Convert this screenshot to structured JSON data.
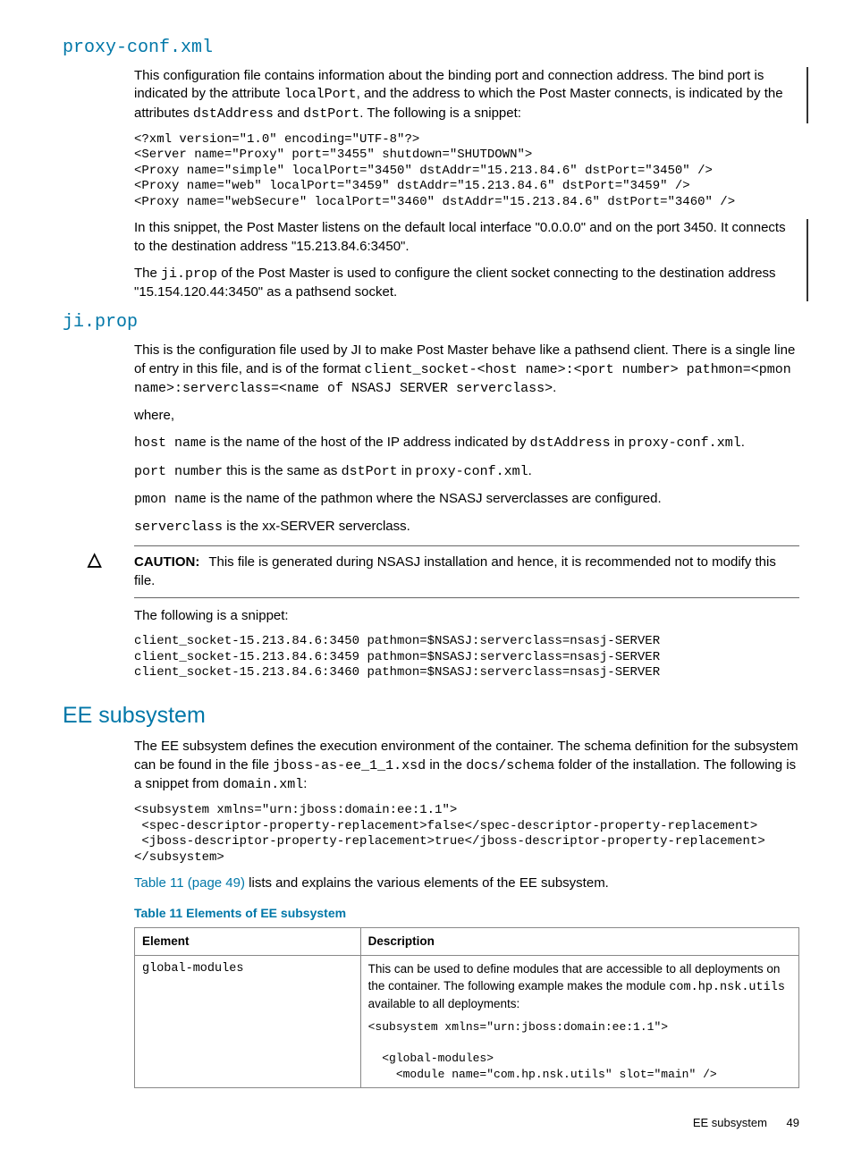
{
  "sections": {
    "proxy": {
      "title": "proxy-conf.xml",
      "p1a": "This configuration file contains information about the binding port and connection address. The bind port is indicated by the attribute ",
      "p1b": "localPort",
      "p1c": ", and the address to which the Post Master connects, is indicated by the attributes ",
      "p1d": "dstAddress",
      "p1e": " and ",
      "p1f": "dstPort",
      "p1g": ". The following is a snippet:",
      "code": "<?xml version=\"1.0\" encoding=\"UTF-8\"?>\n<Server name=\"Proxy\" port=\"3455\" shutdown=\"SHUTDOWN\">\n<Proxy name=\"simple\" localPort=\"3450\" dstAddr=\"15.213.84.6\" dstPort=\"3450\" />\n<Proxy name=\"web\" localPort=\"3459\" dstAddr=\"15.213.84.6\" dstPort=\"3459\" />\n<Proxy name=\"webSecure\" localPort=\"3460\" dstAddr=\"15.213.84.6\" dstPort=\"3460\" />",
      "p2": "In this snippet, the Post Master listens on the default local interface \"0.0.0.0\" and on the port 3450. It connects to the destination address \"15.213.84.6:3450\".",
      "p3a": "The ",
      "p3b": "ji.prop",
      "p3c": " of the Post Master is used to configure the client socket connecting to the destination address \"15.154.120.44:3450\" as a pathsend socket."
    },
    "ji": {
      "title": "ji.prop",
      "p1a": "This is the configuration file used by JI to make Post Master behave like a pathsend client. There is a single line of entry in this file, and is of the format ",
      "p1b": "client_socket-<host name>:<port number> pathmon=<pmon name>:serverclass=<name of NSASJ SERVER serverclass>",
      "p1c": ".",
      "where": "where,",
      "w1a": "host name",
      "w1b": " is the name of the host of the IP address indicated by ",
      "w1c": "dstAddress",
      "w1d": " in ",
      "w1e": "proxy-conf.xml",
      "w1f": ".",
      "w2a": "port number",
      "w2b": " this is the same as ",
      "w2c": "dstPort",
      "w2d": " in ",
      "w2e": "proxy-conf.xml",
      "w2f": ".",
      "w3a": "pmon name",
      "w3b": " is the name of the pathmon where the NSASJ serverclasses are configured.",
      "w4a": "serverclass",
      "w4b": " is the xx-SERVER serverclass.",
      "cautionLabel": "CAUTION:",
      "cautionText": "This file is generated during NSASJ installation and hence, it is recommended not to modify this file.",
      "p2": "The following is a snippet:",
      "code": "client_socket-15.213.84.6:3450 pathmon=$NSASJ:serverclass=nsasj-SERVER\nclient_socket-15.213.84.6:3459 pathmon=$NSASJ:serverclass=nsasj-SERVER\nclient_socket-15.213.84.6:3460 pathmon=$NSASJ:serverclass=nsasj-SERVER"
    },
    "ee": {
      "title": "EE subsystem",
      "p1a": "The EE subsystem defines the execution environment of the container. The schema definition for the subsystem can be found in the file ",
      "p1b": "jboss-as-ee_1_1.xsd",
      "p1c": " in the ",
      "p1d": "docs/schema",
      "p1e": " folder of the installation. The following is a snippet from ",
      "p1f": "domain.xml",
      "p1g": ":",
      "code": "<subsystem xmlns=\"urn:jboss:domain:ee:1.1\">\n <spec-descriptor-property-replacement>false</spec-descriptor-property-replacement>\n <jboss-descriptor-property-replacement>true</jboss-descriptor-property-replacement>\n</subsystem>",
      "p2a": "Table 11 (page 49)",
      "p2b": " lists and explains the various elements of the EE subsystem.",
      "tableTitle": "Table 11 Elements of EE subsystem",
      "th1": "Element",
      "th2": "Description",
      "r1c1": "global-modules",
      "r1c2a": "This can be used to define modules that are accessible to all deployments on the container. The following example makes the module ",
      "r1c2b": "com.hp.nsk.utils",
      "r1c2c": " available to all deployments:",
      "r1code": "<subsystem xmlns=\"urn:jboss:domain:ee:1.1\">\n\n  <global-modules>\n    <module name=\"com.hp.nsk.utils\" slot=\"main\" />"
    }
  },
  "footer": {
    "section": "EE subsystem",
    "page": "49"
  }
}
